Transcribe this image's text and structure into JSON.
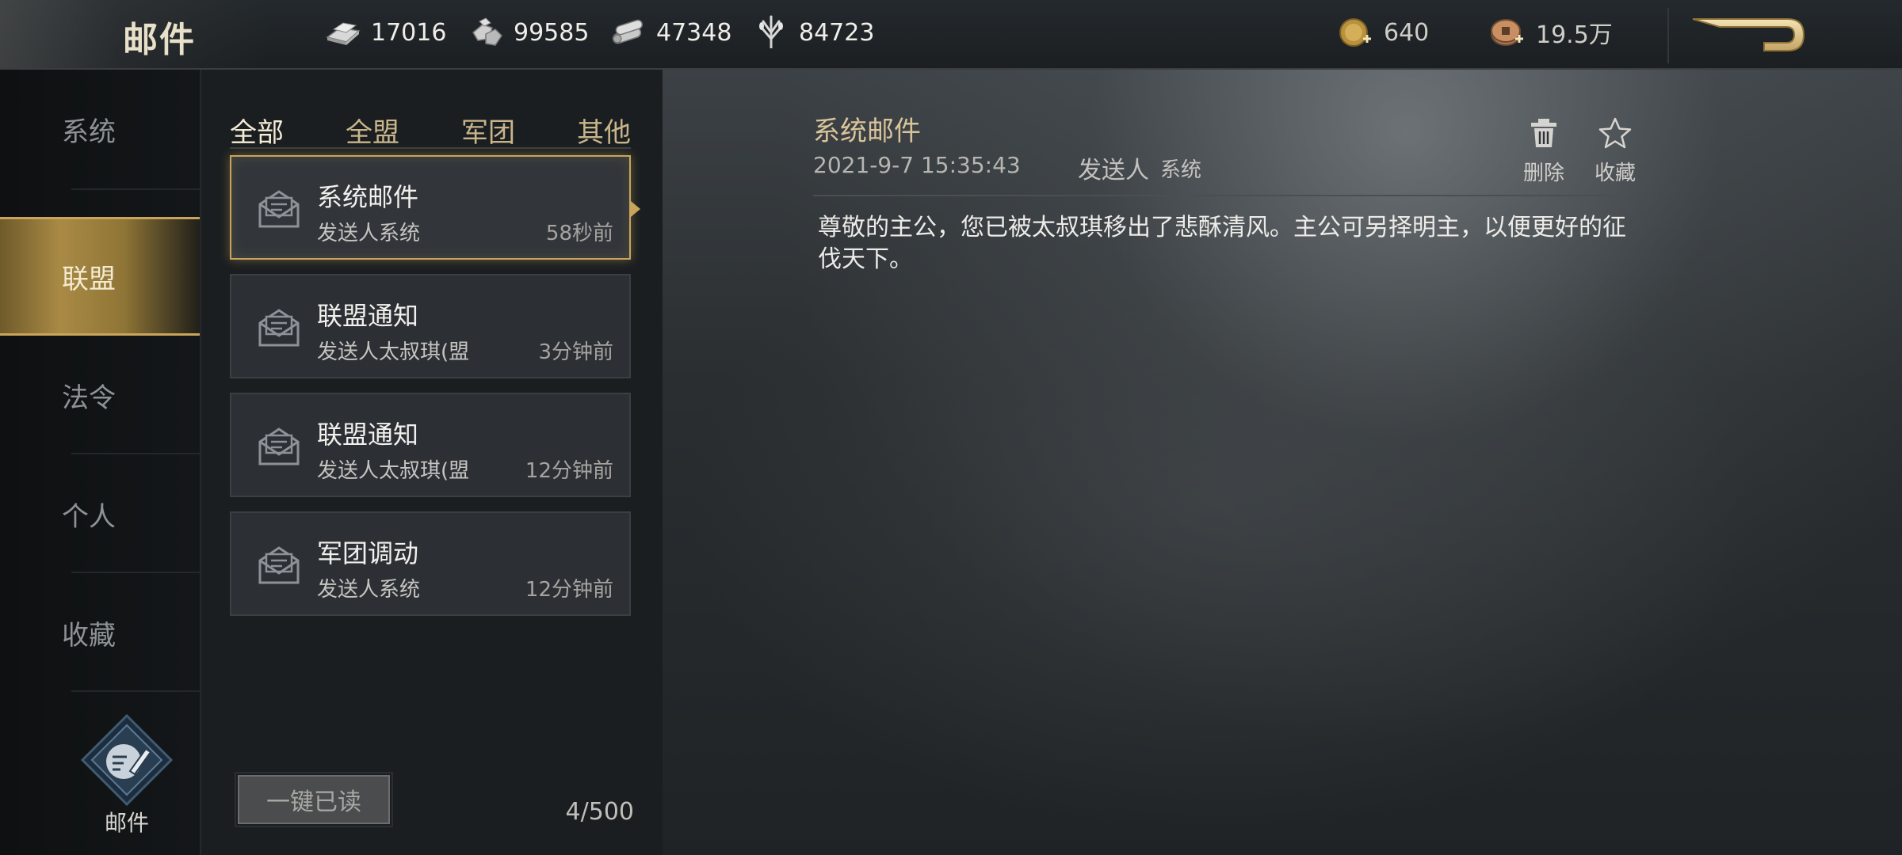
{
  "header": {
    "title": "邮件",
    "resources": [
      {
        "icon": "iron-ingot-icon",
        "value": "17016"
      },
      {
        "icon": "stone-icon",
        "value": "99585"
      },
      {
        "icon": "wood-icon",
        "value": "47348"
      },
      {
        "icon": "grain-icon",
        "value": "84723"
      }
    ],
    "currencies": [
      {
        "icon": "gold-coin-plus-icon",
        "value": "640"
      },
      {
        "icon": "copper-coin-plus-icon",
        "value": "19.5万"
      }
    ],
    "back_icon": "back-arrow-icon"
  },
  "sidebar": {
    "items": [
      {
        "label": "系统"
      },
      {
        "label": "联盟",
        "active": true
      },
      {
        "label": "法令"
      },
      {
        "label": "个人"
      },
      {
        "label": "收藏"
      }
    ],
    "mail_shortcut_label": "邮件"
  },
  "list": {
    "tabs": [
      {
        "label": "全部",
        "active": true
      },
      {
        "label": "全盟"
      },
      {
        "label": "军团"
      },
      {
        "label": "其他"
      }
    ],
    "items": [
      {
        "title": "系统邮件",
        "sender": "发送人系统",
        "time": "58秒前",
        "selected": true
      },
      {
        "title": "联盟通知",
        "sender": "发送人太叔琪(盟",
        "time": "3分钟前"
      },
      {
        "title": "联盟通知",
        "sender": "发送人太叔琪(盟",
        "time": "12分钟前"
      },
      {
        "title": "军团调动",
        "sender": "发送人系统",
        "time": "12分钟前"
      }
    ],
    "read_all_label": "一键已读",
    "count": "4/500"
  },
  "detail": {
    "title": "系统邮件",
    "date": "2021-9-7 15:35:43",
    "sender_label": "发送人",
    "sender": "系统",
    "delete_label": "删除",
    "favorite_label": "收藏",
    "body": "尊敬的主公，您已被太叔琪移出了悲酥清风。主公可另择明主，以便更好的征伐天下。"
  },
  "colors": {
    "accent_gold": "#c7a55b",
    "title_gold": "#d9c49a"
  }
}
